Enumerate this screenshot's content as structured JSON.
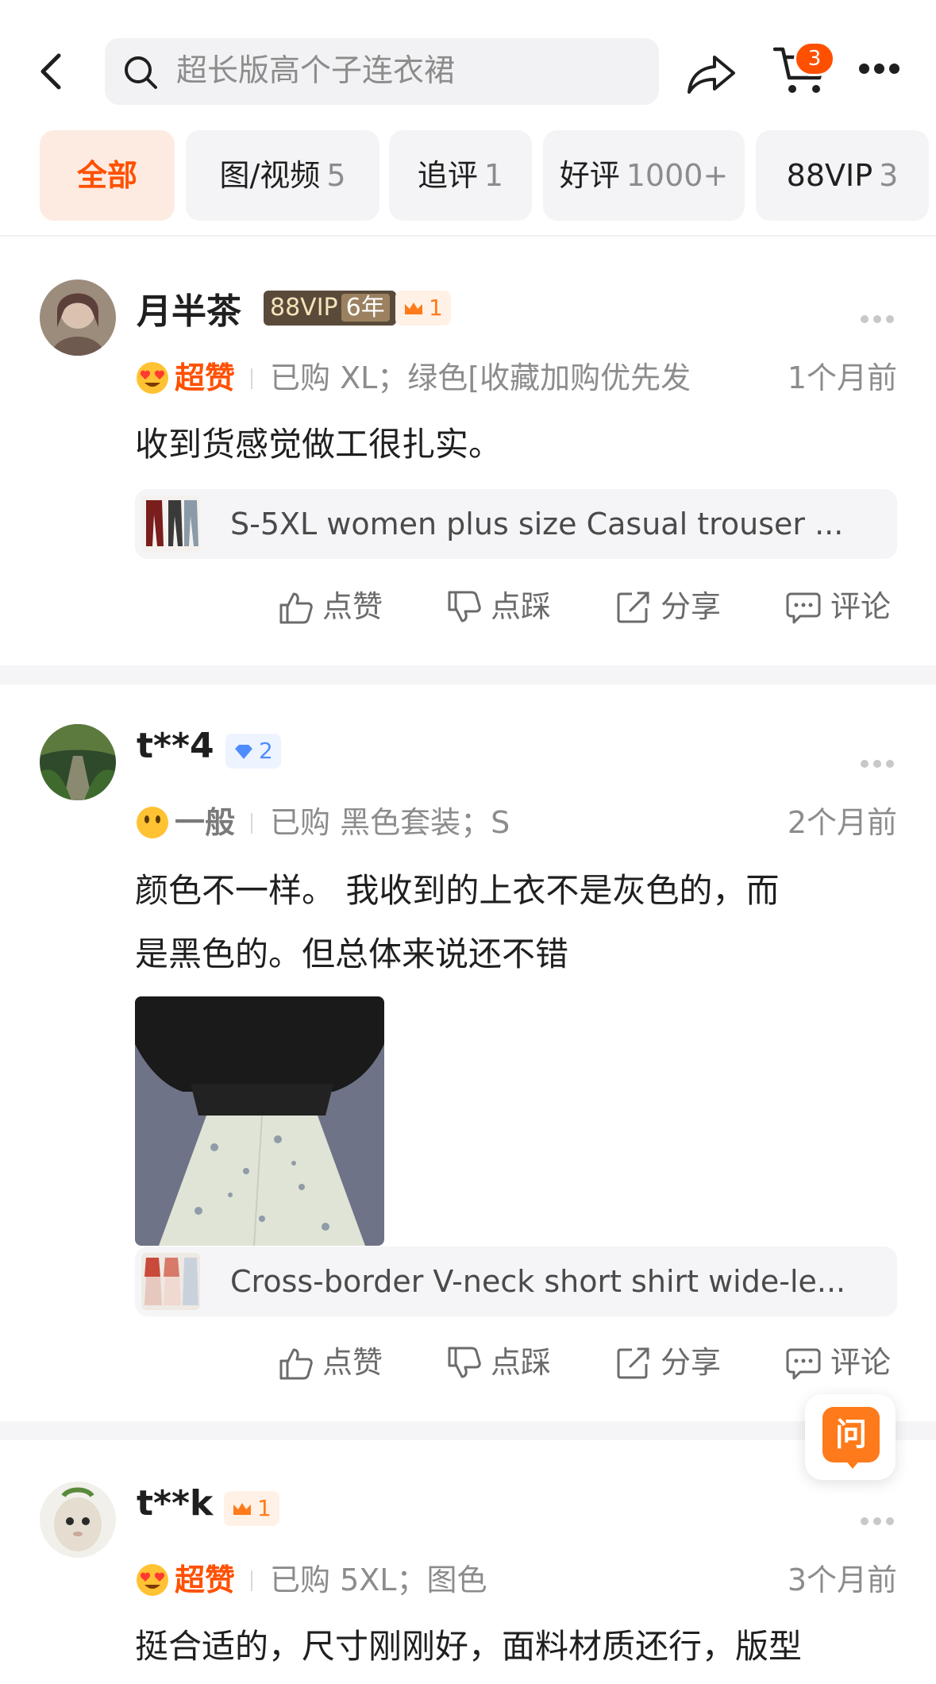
{
  "header": {
    "search_text": "超长版高个子连衣裙",
    "cart_badge": "3"
  },
  "tabs": [
    {
      "label": "全部",
      "count": ""
    },
    {
      "label": "图/视频",
      "count": "5"
    },
    {
      "label": "追评",
      "count": "1"
    },
    {
      "label": "好评",
      "count": "1000+"
    },
    {
      "label": "88VIP",
      "count": "3"
    }
  ],
  "reviews": [
    {
      "username": "月半茶",
      "vip_badge": "88VIP",
      "vip_years": "6年",
      "level": "1",
      "rating": "超赞",
      "purchase": "已购 XL；绿色[收藏加购优先发",
      "time": "1个月前",
      "content": "收到货感觉做工很扎实。",
      "product_title": "S-5XL women plus size Casual trouser ..."
    },
    {
      "username": "t**4",
      "level": "2",
      "rating": "一般",
      "purchase": "已购 黑色套装；S",
      "time": "2个月前",
      "content_line1": "颜色不一样。  我收到的上衣不是灰色的，而",
      "content_line2": "是黑色的。但总体来说还不错",
      "product_title": "Cross-border V-neck short shirt wide-le..."
    },
    {
      "username": "t**k",
      "level": "1",
      "rating": "超赞",
      "purchase": "已购 5XL；图色",
      "time": "3个月前",
      "content": "挺合适的，尺寸刚刚好，面料材质还行，版型"
    }
  ],
  "actions": {
    "like": "点赞",
    "dislike": "点踩",
    "share": "分享",
    "comment": "评论"
  },
  "ask_button": "问",
  "colors": {
    "accent": "#ff5000",
    "accent_light": "#fdebe2",
    "muted": "#8c8c8c"
  }
}
